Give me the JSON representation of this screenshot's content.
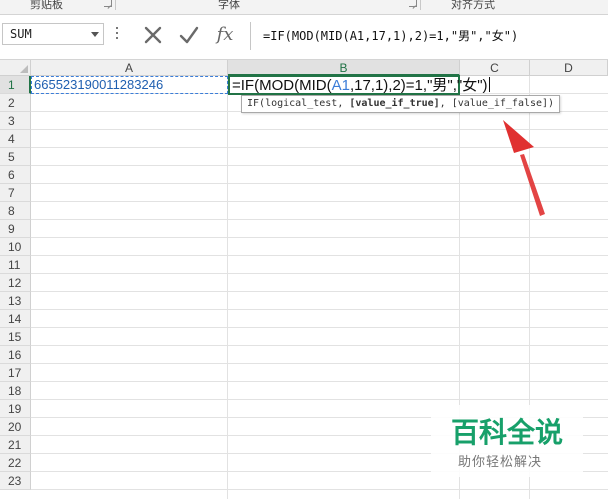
{
  "ribbon": {
    "groups": [
      "剪贴板",
      "字体",
      "对齐方式"
    ]
  },
  "formula_bar": {
    "name_box": "SUM",
    "cancel_icon": "cross-icon",
    "enter_icon": "check-icon",
    "fx_label": "fx",
    "formula": "=IF(MOD(MID(A1,17,1),2)=1,\"男\",\"女\")"
  },
  "grid": {
    "columns": [
      "A",
      "B",
      "C",
      "D"
    ],
    "active_column": "B",
    "rows": [
      "1",
      "2",
      "3",
      "4",
      "5",
      "6",
      "7",
      "8",
      "9",
      "10",
      "11",
      "12",
      "13",
      "14",
      "15",
      "16",
      "17",
      "18",
      "19",
      "20",
      "21",
      "22",
      "23"
    ],
    "active_row": "1"
  },
  "cells": {
    "A1": "665523190011283246",
    "B1_parts": [
      "=IF(MOD(MID(",
      "A1",
      ",17,1),2)=1,\"男\",\"女\")"
    ]
  },
  "tooltip": {
    "func": "IF(",
    "arg1": "logical_test",
    "sep1": ", ",
    "arg2": "[value_if_true]",
    "sep2": ", ",
    "arg3": "[value_if_false]",
    "close": ")"
  },
  "watermark": {
    "title": "百科全说",
    "subtitle": "助你轻松解决"
  },
  "colors": {
    "excel_green": "#217346",
    "arrow_red": "#e03030",
    "watermark_green": "#17a06a"
  }
}
